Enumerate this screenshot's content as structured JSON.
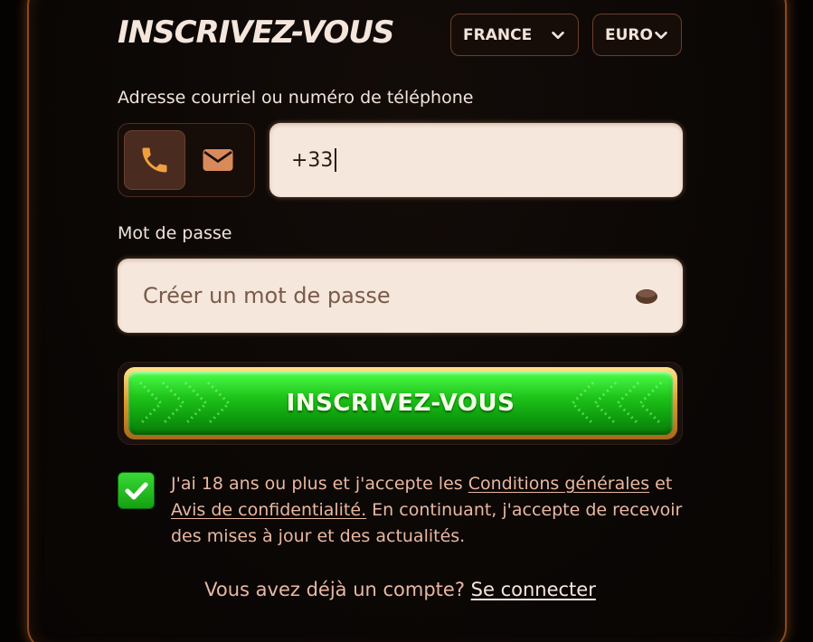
{
  "header": {
    "title": "INSCRIVEZ-VOUS",
    "country_select": "FRANCE",
    "currency_select": "EURO"
  },
  "form": {
    "contact_label": "Adresse courriel ou numéro de téléphone",
    "methods": [
      {
        "name": "phone",
        "icon": "phone-icon",
        "selected": true
      },
      {
        "name": "email",
        "icon": "envelope-icon",
        "selected": false
      }
    ],
    "phone_value": "+33",
    "password_label": "Mot de passe",
    "password_placeholder": "Créer un mot de passe",
    "submit_label": "INSCRIVEZ-VOUS",
    "terms": {
      "checked": true,
      "text_1": "J'ai 18 ans ou plus et j'accepte les ",
      "link_conditions": "Conditions générales",
      "text_2": " et ",
      "link_privacy": "Avis de confidentialité.",
      "text_3": " En continuant, j'accepte de recevoir des mises à jour et des actualités."
    },
    "login_prompt": "Vous avez déjà un compte?",
    "login_link": "Se connecter"
  },
  "colors": {
    "accent_green": "#1ec41a",
    "panel_border": "#8a4a1c",
    "input_bg": "#f6e7dc",
    "icon_orange": "#f0a040"
  }
}
